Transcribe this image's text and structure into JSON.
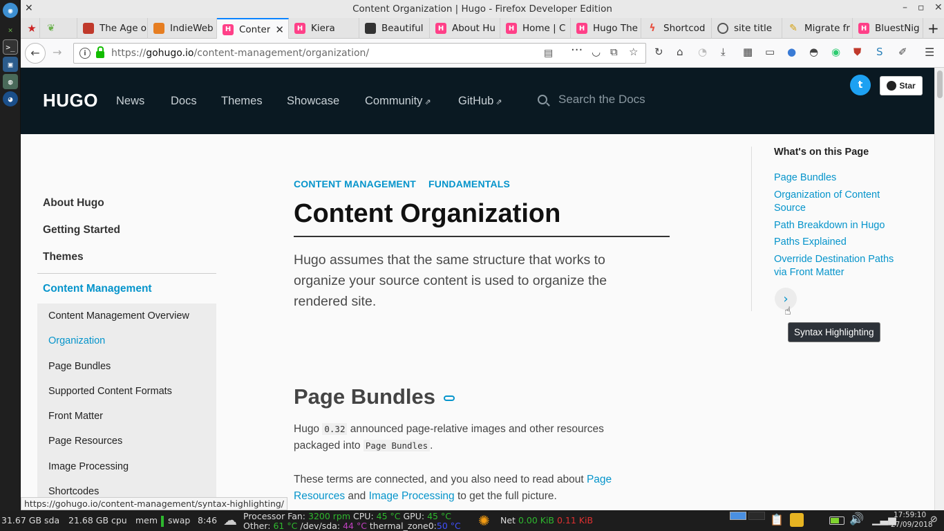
{
  "window": {
    "title": "Content Organization | Hugo - Firefox Developer Edition"
  },
  "tabs": [
    {
      "label": "",
      "icon": "red-star-icon",
      "color": "#cc2222"
    },
    {
      "label": "",
      "icon": "green-leaf-icon",
      "color": "#6ab04c"
    },
    {
      "label": "The Age o",
      "icon": "age-favicon",
      "color": "#c0392b"
    },
    {
      "label": "IndieWeb",
      "icon": "indieweb-favicon",
      "color": "#e67e22"
    },
    {
      "label": "Conter",
      "icon": "hugo-favicon",
      "color": "#ff4088",
      "active": true
    },
    {
      "label": "Kiera",
      "icon": "hugo-favicon",
      "color": "#ff4088"
    },
    {
      "label": "Beautiful",
      "icon": "bookmark-favicon",
      "color": "#333333"
    },
    {
      "label": "About Hu",
      "icon": "hugo-favicon",
      "color": "#ff4088"
    },
    {
      "label": "Home | C",
      "icon": "hugo-favicon",
      "color": "#ff4088"
    },
    {
      "label": "Hugo The",
      "icon": "hugo-favicon",
      "color": "#ff4088"
    },
    {
      "label": "Shortcod",
      "icon": "bolt-favicon",
      "color": "#e74c3c"
    },
    {
      "label": "site title",
      "icon": "circle-favicon",
      "color": "#555555"
    },
    {
      "label": "Migrate fr",
      "icon": "pencil-favicon",
      "color": "#f1c40f"
    },
    {
      "label": "BluestNig",
      "icon": "hugo-favicon",
      "color": "#ff4088"
    }
  ],
  "navbar": {
    "url_prefix": "https://",
    "url_host": "gohugo.io",
    "url_path": "/content-management/organization/"
  },
  "hugo": {
    "logo": "HUGO",
    "nav": [
      "News",
      "Docs",
      "Themes",
      "Showcase",
      "Community",
      "GitHub"
    ],
    "search_placeholder": "Search the Docs",
    "star_label": "Star"
  },
  "sidebar": {
    "sections": [
      "About Hugo",
      "Getting Started",
      "Themes"
    ],
    "active_section": "Content Management",
    "items": [
      "Content Management Overview",
      "Organization",
      "Page Bundles",
      "Supported Content Formats",
      "Front Matter",
      "Page Resources",
      "Image Processing",
      "Shortcodes"
    ],
    "active_item": "Organization"
  },
  "main": {
    "crumbs": [
      "CONTENT MANAGEMENT",
      "FUNDAMENTALS"
    ],
    "title": "Content Organization",
    "lead": "Hugo assumes that the same structure that works to organize your source content is used to organize the rendered site.",
    "h2": "Page Bundles",
    "p1_a": "Hugo ",
    "p1_code1": "0.32",
    "p1_b": " announced page-relative images and other resources packaged into ",
    "p1_code2": "Page Bundles",
    "p1_c": ".",
    "p2_a": "These terms are connected, and you also need to read about ",
    "p2_link1": "Page Resources",
    "p2_b": " and ",
    "p2_link2": "Image Processing",
    "p2_c": " to get the full picture."
  },
  "toc": {
    "title": "What's on this Page",
    "links": [
      "Page Bundles",
      "Organization of Content Source",
      "Path Breakdown in Hugo",
      "Paths Explained",
      "Override Destination Paths via Front Matter"
    ],
    "tooltip": "Syntax Highlighting"
  },
  "status_link": "https://gohugo.io/content-management/syntax-highlighting/",
  "taskbar": {
    "sda": "31.67 GB sda",
    "cpu": "21.68 GB cpu",
    "mem": "mem",
    "swap": "swap",
    "time_small": "8:46",
    "fan_label": "Processor Fan:",
    "fan_val": "3200 rpm",
    "cpu_label": "CPU:",
    "cpu_val": "45 °C",
    "gpu_label": "GPU:",
    "gpu_val": "45 °C",
    "other_label": "Other:",
    "other_val": "61 °C",
    "sda_label": "/dev/sda:",
    "sda_val": "44 °C",
    "thermal_label": "thermal_zone0:",
    "thermal_val": "50 °C",
    "net_label": "Net",
    "net_down": "0.00 KiB",
    "net_up": "0.11 KiB",
    "clock_time": "17:59:10",
    "clock_date": "27/09/2018"
  }
}
